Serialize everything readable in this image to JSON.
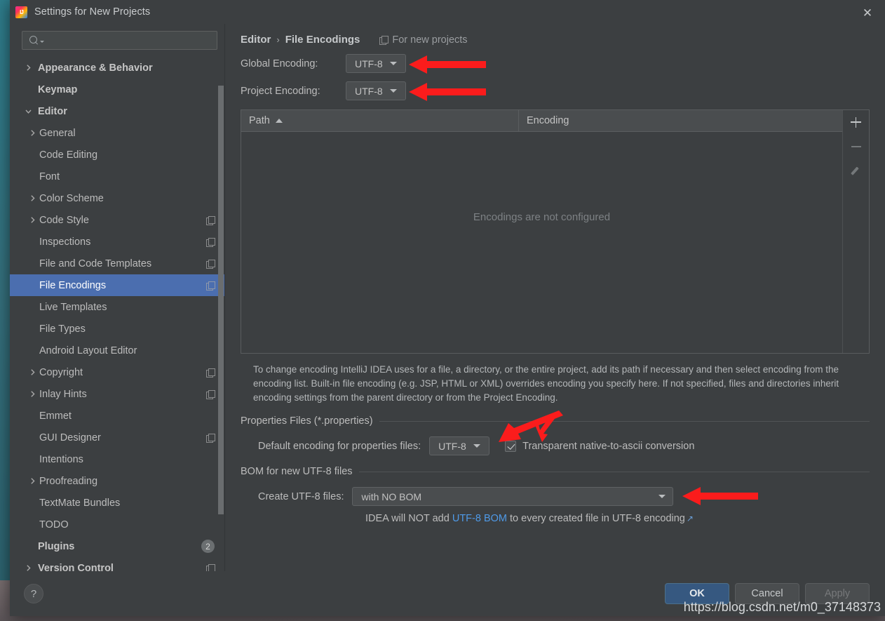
{
  "window": {
    "title": "Settings for New Projects",
    "app_icon": "intellij-idea-icon",
    "close_label": "✕"
  },
  "sidebar": {
    "search": {
      "placeholder": "",
      "value": "",
      "icon": "search-icon"
    },
    "items": [
      {
        "label": "Appearance & Behavior",
        "indent": 0,
        "expandable": true,
        "expanded": false,
        "bold": true,
        "copy": false,
        "selected": false
      },
      {
        "label": "Keymap",
        "indent": 0,
        "expandable": false,
        "expanded": false,
        "bold": true,
        "copy": false,
        "selected": false
      },
      {
        "label": "Editor",
        "indent": 0,
        "expandable": true,
        "expanded": true,
        "bold": true,
        "copy": false,
        "selected": false
      },
      {
        "label": "General",
        "indent": 1,
        "expandable": true,
        "expanded": false,
        "bold": false,
        "copy": false,
        "selected": false
      },
      {
        "label": "Code Editing",
        "indent": 1,
        "expandable": false,
        "expanded": false,
        "bold": false,
        "copy": false,
        "selected": false
      },
      {
        "label": "Font",
        "indent": 1,
        "expandable": false,
        "expanded": false,
        "bold": false,
        "copy": false,
        "selected": false
      },
      {
        "label": "Color Scheme",
        "indent": 1,
        "expandable": true,
        "expanded": false,
        "bold": false,
        "copy": false,
        "selected": false
      },
      {
        "label": "Code Style",
        "indent": 1,
        "expandable": true,
        "expanded": false,
        "bold": false,
        "copy": true,
        "selected": false
      },
      {
        "label": "Inspections",
        "indent": 1,
        "expandable": false,
        "expanded": false,
        "bold": false,
        "copy": true,
        "selected": false
      },
      {
        "label": "File and Code Templates",
        "indent": 1,
        "expandable": false,
        "expanded": false,
        "bold": false,
        "copy": true,
        "selected": false
      },
      {
        "label": "File Encodings",
        "indent": 1,
        "expandable": false,
        "expanded": false,
        "bold": false,
        "copy": true,
        "selected": true
      },
      {
        "label": "Live Templates",
        "indent": 1,
        "expandable": false,
        "expanded": false,
        "bold": false,
        "copy": false,
        "selected": false
      },
      {
        "label": "File Types",
        "indent": 1,
        "expandable": false,
        "expanded": false,
        "bold": false,
        "copy": false,
        "selected": false
      },
      {
        "label": "Android Layout Editor",
        "indent": 1,
        "expandable": false,
        "expanded": false,
        "bold": false,
        "copy": false,
        "selected": false
      },
      {
        "label": "Copyright",
        "indent": 1,
        "expandable": true,
        "expanded": false,
        "bold": false,
        "copy": true,
        "selected": false
      },
      {
        "label": "Inlay Hints",
        "indent": 1,
        "expandable": true,
        "expanded": false,
        "bold": false,
        "copy": true,
        "selected": false
      },
      {
        "label": "Emmet",
        "indent": 1,
        "expandable": false,
        "expanded": false,
        "bold": false,
        "copy": false,
        "selected": false
      },
      {
        "label": "GUI Designer",
        "indent": 1,
        "expandable": false,
        "expanded": false,
        "bold": false,
        "copy": true,
        "selected": false
      },
      {
        "label": "Intentions",
        "indent": 1,
        "expandable": false,
        "expanded": false,
        "bold": false,
        "copy": false,
        "selected": false
      },
      {
        "label": "Proofreading",
        "indent": 1,
        "expandable": true,
        "expanded": false,
        "bold": false,
        "copy": false,
        "selected": false
      },
      {
        "label": "TextMate Bundles",
        "indent": 1,
        "expandable": false,
        "expanded": false,
        "bold": false,
        "copy": false,
        "selected": false
      },
      {
        "label": "TODO",
        "indent": 1,
        "expandable": false,
        "expanded": false,
        "bold": false,
        "copy": false,
        "selected": false
      },
      {
        "label": "Plugins",
        "indent": 0,
        "expandable": false,
        "expanded": false,
        "bold": true,
        "copy": false,
        "selected": false,
        "badge": "2"
      },
      {
        "label": "Version Control",
        "indent": 0,
        "expandable": true,
        "expanded": false,
        "bold": true,
        "copy": true,
        "selected": false
      }
    ]
  },
  "main": {
    "breadcrumb": {
      "parent": "Editor",
      "separator": "›",
      "current": "File Encodings"
    },
    "scope_label": "For new projects",
    "scope_icon": "copy-scope-icon",
    "global_encoding": {
      "label": "Global Encoding:",
      "value": "UTF-8"
    },
    "project_encoding": {
      "label": "Project Encoding:",
      "value": "UTF-8"
    },
    "table": {
      "columns": [
        "Path",
        "Encoding"
      ],
      "sort_column": "Path",
      "sort_direction": "asc",
      "rows": [],
      "empty_message": "Encodings are not configured",
      "toolbar": {
        "add": "+",
        "remove": "−",
        "edit": "edit-pencil-icon"
      }
    },
    "description": "To change encoding IntelliJ IDEA uses for a file, a directory, or the entire project, add its path if necessary and then select encoding from the encoding list. Built-in file encoding (e.g. JSP, HTML or XML) overrides encoding you specify here. If not specified, files and directories inherit encoding settings from the parent directory or from the Project Encoding.",
    "properties_group": {
      "title": "Properties Files (*.properties)",
      "default_encoding_label": "Default encoding for properties files:",
      "default_encoding_value": "UTF-8",
      "transparent_label": "Transparent native-to-ascii conversion",
      "transparent_checked": true
    },
    "bom_group": {
      "title": "BOM for new UTF-8 files",
      "create_label": "Create UTF-8 files:",
      "create_value": "with NO BOM",
      "hint_prefix": "IDEA will NOT add ",
      "hint_link": "UTF-8 BOM",
      "hint_suffix": " to every created file in UTF-8 encoding",
      "hint_ext_icon": "↗"
    }
  },
  "footer": {
    "help_label": "?",
    "ok_label": "OK",
    "cancel_label": "Cancel",
    "apply_label": "Apply"
  },
  "overlay": {
    "watermark": "https://blog.csdn.net/m0_37148373"
  },
  "colors": {
    "dialog_bg": "#3c3f41",
    "selection_blue": "#4b6eaf",
    "primary_button": "#365880",
    "link_blue": "#4f9ae8",
    "annotation_red": "#fb1c1c"
  }
}
